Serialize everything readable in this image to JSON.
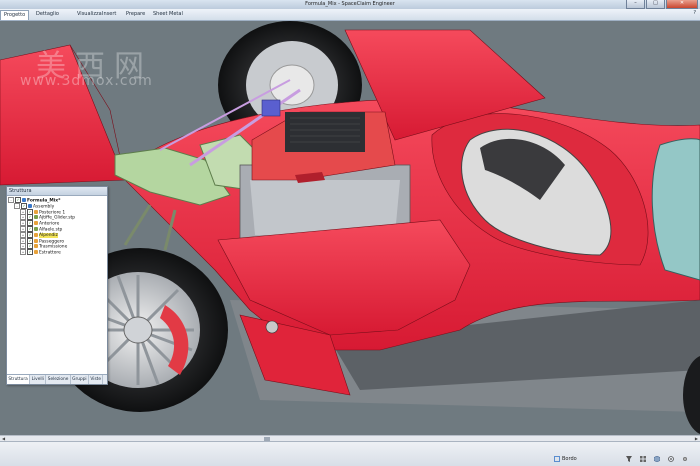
{
  "window": {
    "title": "Formula_Mix - SpaceClaim Engineer",
    "minimize": "–",
    "maximize": "□",
    "close": "✕"
  },
  "ribbon": {
    "tabs": [
      "Progetto",
      "Dettaglio",
      "Visualizza",
      "Insert",
      "Prepare",
      "Sheet Metal"
    ],
    "active_tab": 0,
    "help": "?"
  },
  "watermark": {
    "cn": "美西网",
    "url": "www.3dmox.com"
  },
  "structure_panel": {
    "title": "Struttura",
    "tree": [
      {
        "label": "Formula_Mix*",
        "level": 0,
        "expander": "-",
        "checked": true,
        "icon": "#3a78c9",
        "bold": true
      },
      {
        "label": "Assembly",
        "level": 1,
        "expander": "-",
        "checked": true,
        "icon": "#3a78c9"
      },
      {
        "label": "Posteriore 1",
        "level": 2,
        "expander": "+",
        "checked": true,
        "icon": "#e8a23a"
      },
      {
        "label": "Ajtiffe_Glider.stp",
        "level": 2,
        "expander": "+",
        "checked": true,
        "icon": "#7aa04a"
      },
      {
        "label": "Anteriore",
        "level": 2,
        "expander": "+",
        "checked": true,
        "icon": "#e8a23a"
      },
      {
        "label": "Alfaele.stp",
        "level": 2,
        "expander": "+",
        "checked": true,
        "icon": "#7aa04a"
      },
      {
        "label": "Alpendiz",
        "level": 2,
        "expander": "+",
        "checked": true,
        "icon": "#e8a23a",
        "highlight": true
      },
      {
        "label": "Passeggero",
        "level": 2,
        "expander": "+",
        "checked": true,
        "icon": "#e8a23a"
      },
      {
        "label": "Trasmissione",
        "level": 2,
        "expander": "+",
        "checked": true,
        "icon": "#e8a23a"
      },
      {
        "label": "Estrattore",
        "level": 2,
        "expander": "+",
        "checked": true,
        "icon": "#e8a23a"
      }
    ],
    "bottom_tabs": [
      "Struttura",
      "Livelli",
      "Selezione",
      "Gruppi",
      "Viste"
    ],
    "active_bottom_tab": 0
  },
  "statusbar": {
    "status_text": "Bordo"
  },
  "colors": {
    "body_red": "#ef2a42",
    "background": "#6f7a80",
    "engine_red": "#e54a4c",
    "suspension_green": "#b4d6a0",
    "cockpit_blue": "#94c7c6"
  }
}
